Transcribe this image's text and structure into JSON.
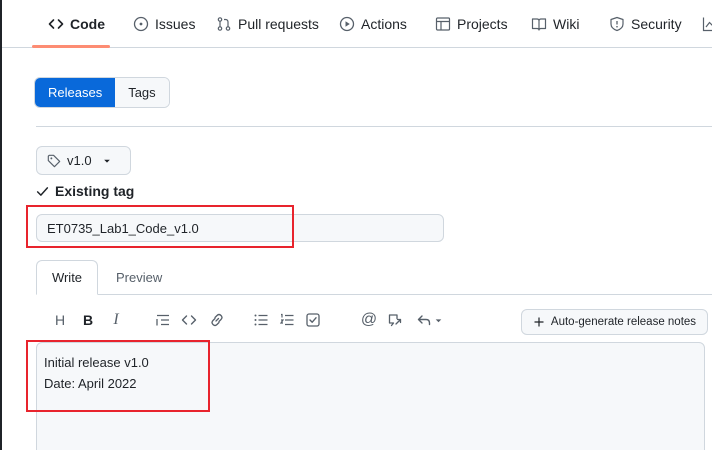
{
  "nav": {
    "tabs": [
      {
        "label": "Code",
        "icon": "code-icon",
        "selected": true
      },
      {
        "label": "Issues",
        "icon": "issue-opened-icon",
        "selected": false
      },
      {
        "label": "Pull requests",
        "icon": "git-pull-request-icon",
        "selected": false
      },
      {
        "label": "Actions",
        "icon": "play-icon",
        "selected": false
      },
      {
        "label": "Projects",
        "icon": "table-icon",
        "selected": false
      },
      {
        "label": "Wiki",
        "icon": "book-icon",
        "selected": false
      },
      {
        "label": "Security",
        "icon": "shield-icon",
        "selected": false
      }
    ]
  },
  "releases_toggle": {
    "releases_label": "Releases",
    "tags_label": "Tags"
  },
  "tag": {
    "selected": "v1.0",
    "status": "Existing tag"
  },
  "release_title": {
    "value": "ET0735_Lab1_Code_v1.0"
  },
  "editor": {
    "write_label": "Write",
    "preview_label": "Preview",
    "toolbar": {
      "heading": "H",
      "bold": "B",
      "italic": "I",
      "mention": "@"
    },
    "auto_generate_label": "Auto-generate release notes",
    "body_text": "Initial release v1.0\nDate: April 2022"
  },
  "colors": {
    "accent": "#0969da",
    "highlight": "#e8242d",
    "tab_underline": "#fd8c73"
  }
}
